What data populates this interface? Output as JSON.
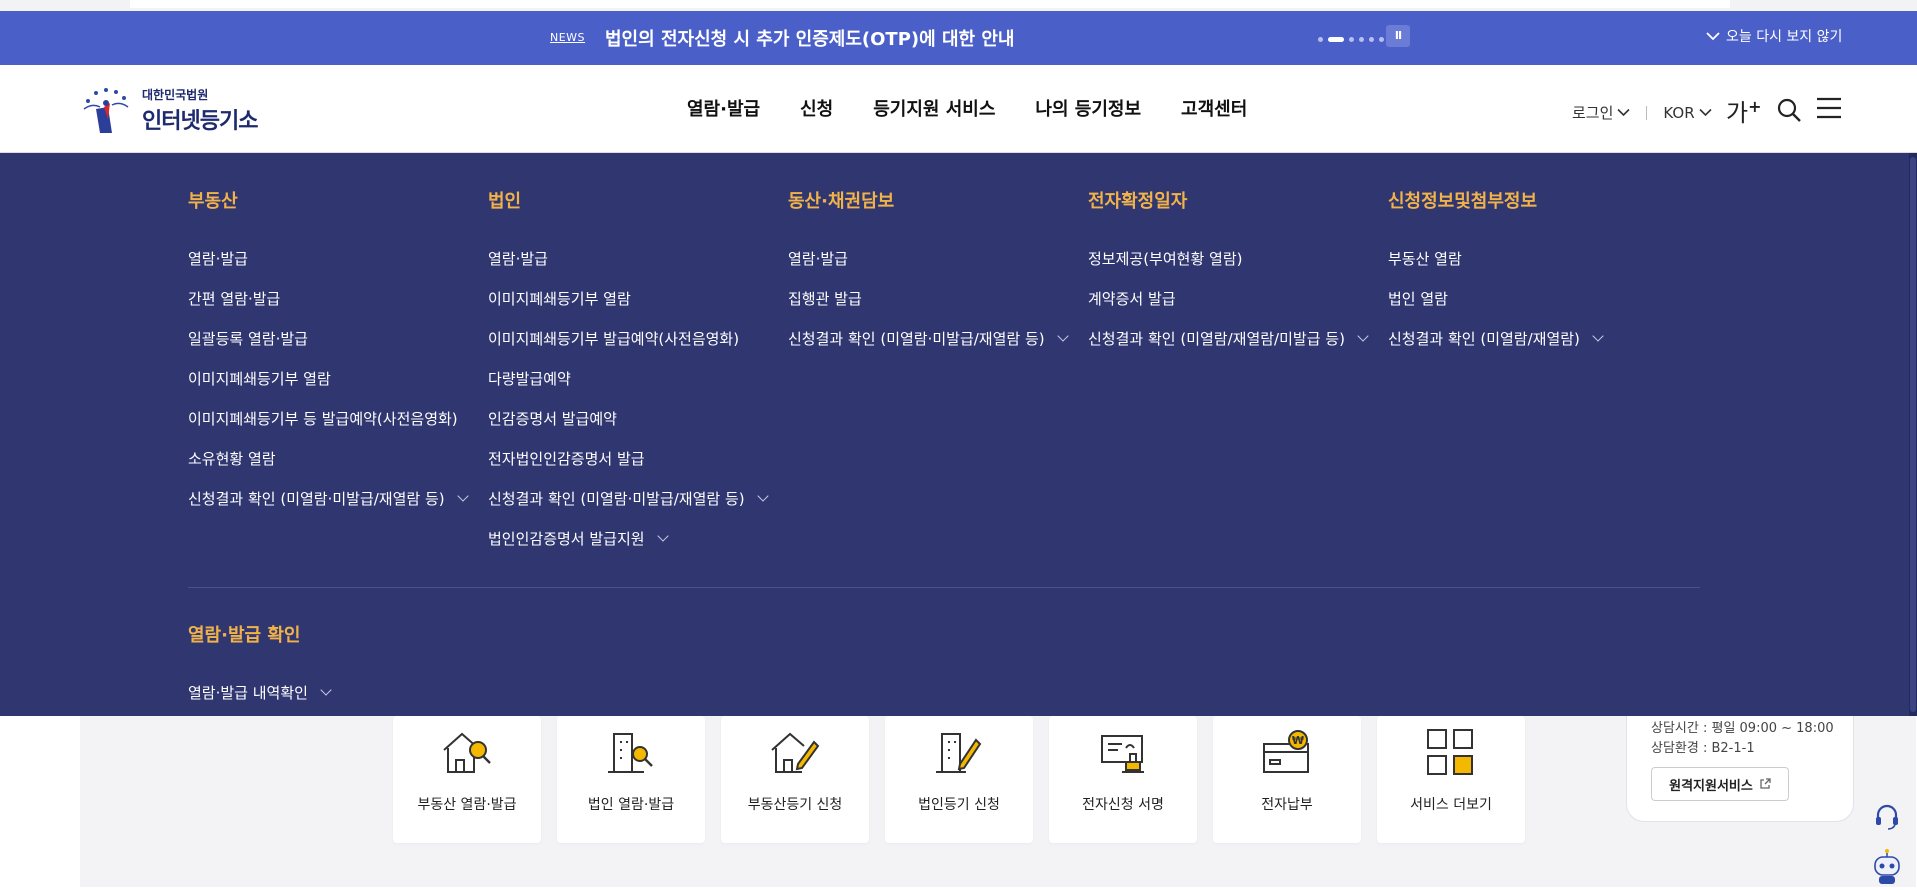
{
  "news": {
    "tag": "NEWS",
    "text": "법인의 전자신청 시 추가 인증제도(OTP)에 대한 안내",
    "pause_label": "II",
    "close_label": "오늘 다시 보지 않기"
  },
  "logo": {
    "small": "대한민국법원",
    "big": "인터넷등기소"
  },
  "gnb": [
    "열람·발급",
    "신청",
    "등기지원 서비스",
    "나의 등기정보",
    "고객센터"
  ],
  "util": {
    "login": "로그인",
    "lang": "KOR",
    "font_size": "가",
    "font_size_plus": "+"
  },
  "mega": {
    "columns": [
      {
        "title": "부동산",
        "items": [
          {
            "label": "열람·발급",
            "chevron": false
          },
          {
            "label": "간편 열람·발급",
            "chevron": false
          },
          {
            "label": "일괄등록 열람·발급",
            "chevron": false
          },
          {
            "label": "이미지폐쇄등기부 열람",
            "chevron": false
          },
          {
            "label": "이미지폐쇄등기부 등 발급예약(사전음영화)",
            "chevron": false
          },
          {
            "label": "소유현황 열람",
            "chevron": false
          },
          {
            "label": "신청결과 확인 (미열람·미발급/재열람 등)",
            "chevron": true
          }
        ]
      },
      {
        "title": "법인",
        "items": [
          {
            "label": "열람·발급",
            "chevron": false
          },
          {
            "label": "이미지폐쇄등기부 열람",
            "chevron": false
          },
          {
            "label": "이미지폐쇄등기부 발급예약(사전음영화)",
            "chevron": false
          },
          {
            "label": "다량발급예약",
            "chevron": false
          },
          {
            "label": "인감증명서 발급예약",
            "chevron": false
          },
          {
            "label": "전자법인인감증명서 발급",
            "chevron": false
          },
          {
            "label": "신청결과 확인 (미열람·미발급/재열람 등)",
            "chevron": true
          },
          {
            "label": "법인인감증명서 발급지원",
            "chevron": true
          }
        ]
      },
      {
        "title": "동산·채권담보",
        "items": [
          {
            "label": "열람·발급",
            "chevron": false
          },
          {
            "label": "집행관 발급",
            "chevron": false
          },
          {
            "label": "신청결과 확인 (미열람·미발급/재열람 등)",
            "chevron": true
          }
        ]
      },
      {
        "title": "전자확정일자",
        "items": [
          {
            "label": "정보제공(부여현황 열람)",
            "chevron": false
          },
          {
            "label": "계약증서 발급",
            "chevron": false
          },
          {
            "label": "신청결과 확인 (미열람/재열람/미발급 등)",
            "chevron": true
          }
        ]
      },
      {
        "title": "신청정보및첨부정보",
        "items": [
          {
            "label": "부동산 열람",
            "chevron": false
          },
          {
            "label": "법인 열람",
            "chevron": false
          },
          {
            "label": "신청결과 확인 (미열람/재열람)",
            "chevron": true
          }
        ]
      }
    ],
    "bottom": {
      "title": "열람·발급 확인",
      "items": [
        {
          "label": "열람·발급 내역확인",
          "chevron": true
        }
      ]
    }
  },
  "services": [
    {
      "label": "부동산 열람·발급",
      "icon": "house-search-icon"
    },
    {
      "label": "법인 열람·발급",
      "icon": "building-search-icon"
    },
    {
      "label": "부동산등기 신청",
      "icon": "house-pen-icon"
    },
    {
      "label": "법인등기 신청",
      "icon": "building-pen-icon"
    },
    {
      "label": "전자신청 서명",
      "icon": "sign-stamp-icon"
    },
    {
      "label": "전자납부",
      "icon": "won-card-icon"
    },
    {
      "label": "서비스 더보기",
      "icon": "grid-more-icon"
    }
  ],
  "consult": {
    "hours": "상담시간 : 평일 09:00 ~ 18:00",
    "env": "상담환경 : B2-1-1",
    "remote_btn": "원격지원서비스"
  },
  "colors": {
    "news_bg": "#4b5fc9",
    "mega_bg": "#2f3670",
    "accent_title": "#f2b24a",
    "icon_yellow": "#f5b800"
  }
}
